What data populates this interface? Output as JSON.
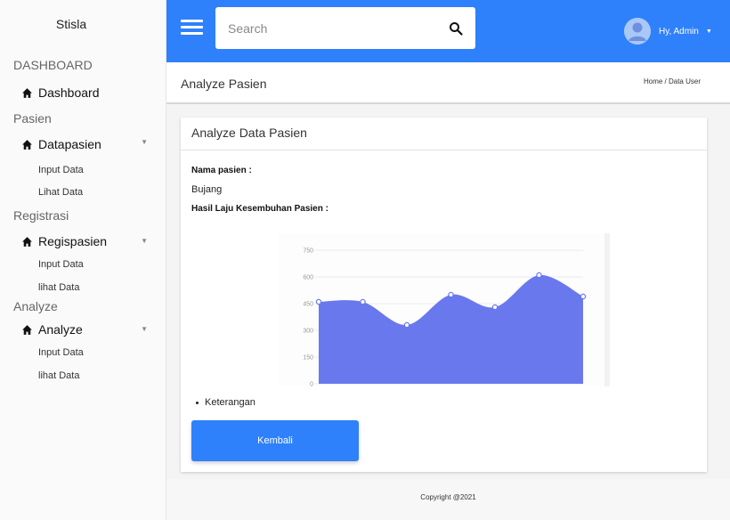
{
  "sidebar": {
    "brand": "Stisla",
    "sections": [
      {
        "title": "DASHBOARD",
        "item": {
          "label": "Dashboard",
          "icon": "home-icon",
          "has_caret": false
        },
        "subitems": []
      },
      {
        "title": "Pasien",
        "item": {
          "label": "Datapasien",
          "icon": "home-icon",
          "has_caret": true
        },
        "subitems": [
          "Input Data",
          "Lihat Data"
        ]
      },
      {
        "title": "Registrasi",
        "item": {
          "label": "Regispasien",
          "icon": "home-icon",
          "has_caret": true
        },
        "subitems": [
          "Input Data",
          "lihat Data"
        ]
      },
      {
        "title": "Analyze",
        "item": {
          "label": "Analyze",
          "icon": "home-icon",
          "has_caret": true
        },
        "subitems": [
          "Input Data",
          "lihat Data"
        ]
      }
    ]
  },
  "header": {
    "menu_icon": "hamburger-icon",
    "search": {
      "placeholder": "Search",
      "value": "",
      "icon": "search-icon"
    },
    "user": {
      "name": "Hy, Admin",
      "avatar_icon": "user-avatar-icon",
      "caret_icon": "caret-down-icon"
    },
    "bg_color": "#2f80fb"
  },
  "page": {
    "title": "Analyze Pasien",
    "breadcrumb": "Home / Data User"
  },
  "card": {
    "title": "Analyze Data Pasien",
    "name_label": "Nama pasien :",
    "name_value": "Bujang",
    "result_label": "Hasil Laju Kesembuhan Pasien :",
    "legend_text": "Keterangan",
    "back_button": "Kembali"
  },
  "chart_data": {
    "type": "area",
    "title": "",
    "xlabel": "",
    "ylabel": "",
    "x": [
      1,
      2,
      3,
      4,
      5,
      6,
      7
    ],
    "values": [
      460,
      460,
      330,
      500,
      430,
      610,
      490
    ],
    "ylim": [
      0,
      750
    ],
    "yticks": [
      "0",
      "150",
      "300",
      "450",
      "600",
      "750"
    ],
    "grid": true,
    "fill_color": "#6a78ee"
  },
  "footer": {
    "text": "Copyright @2021"
  }
}
